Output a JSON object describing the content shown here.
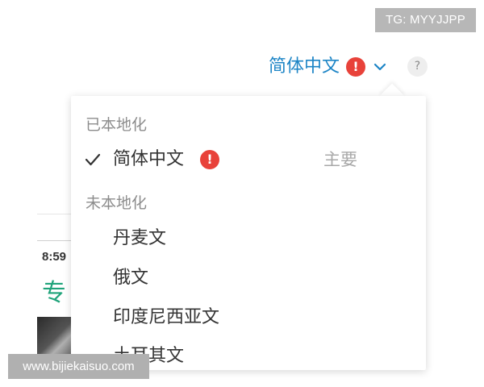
{
  "watermarks": {
    "top": "TG: MYYJJPP",
    "bottom": "www.bijiekaisuo.com"
  },
  "language_selector": {
    "current": "简体中文",
    "alert_symbol": "!",
    "help_symbol": "?"
  },
  "background_page": {
    "time": "8:59",
    "title_fragment": "专"
  },
  "dropdown": {
    "localized_heading": "已本地化",
    "localized_items": [
      {
        "label": "简体中文",
        "alert_symbol": "!",
        "badge": "主要",
        "selected": true
      }
    ],
    "unlocalized_heading": "未本地化",
    "unlocalized_items": [
      {
        "label": "丹麦文"
      },
      {
        "label": "俄文"
      },
      {
        "label": "印度尼西亚文"
      },
      {
        "label": "土耳其文"
      }
    ]
  },
  "colors": {
    "accent": "#1d85c6",
    "alert": "#e8423a",
    "muted_text": "#8c8c8c",
    "badge_text": "#a8a8a8",
    "background_green": "#1fa37a"
  }
}
